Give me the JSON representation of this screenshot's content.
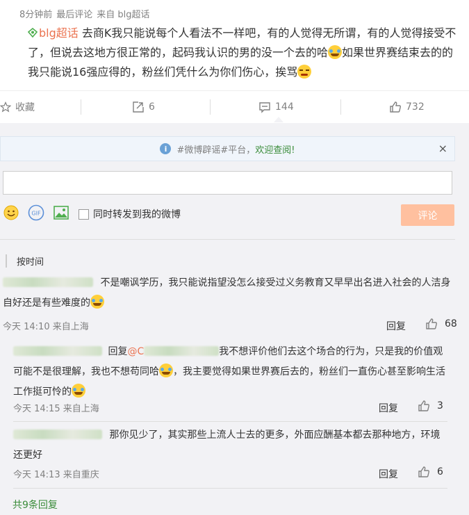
{
  "post": {
    "meta_time": "8分钟前",
    "meta_edit": "最后评论",
    "meta_source": "来自 blg超话",
    "topic": "blg超话",
    "text": "去商K我只能说每个人看法不一样吧，有的人觉得无所谓，有的人觉得接受不了，但说去这地方很正常的，起码我认识的男的没一个去的哈",
    "text2": "如果世界赛结束去的的我只能说16强应得的，粉丝们凭什么为你们伤心，挨骂"
  },
  "actions": {
    "favorite": "收藏",
    "repost_count": "6",
    "comment_count": "144",
    "like_count": "732"
  },
  "notice": {
    "prefix": "#微博辟谣#平台，",
    "highlight": "欢迎查阅!",
    "close": "×"
  },
  "composer": {
    "repost_label": "同时转发到我的微博",
    "submit": "评论"
  },
  "sort": {
    "label": "按时间"
  },
  "comments": [
    {
      "text": "不是嘲讽学历，我只能说指望没怎么接受过义务教育又早早出名进入社会的人洁身自好还是有些难度的",
      "time": "今天 14:10 来自上海",
      "reply": "回复",
      "likes": "68"
    }
  ],
  "replies": [
    {
      "prefix": "回复",
      "mention": "@C",
      "text": "我不想评价他们去这个场合的行为，只是我的价值观可能不是很理解，我也不想苟同哈",
      "text2": "，我主要觉得如果世界赛后去的，粉丝们一直伤心甚至影响生活工作挺可怜的",
      "time": "今天 14:15 来自上海",
      "reply": "回复",
      "likes": "3"
    },
    {
      "text": "那你见少了，其实那些上流人士去的更多，外面应酬基本都去那种地方，环境还更好",
      "time": "今天 14:13 来自重庆",
      "reply": "回复",
      "likes": "6"
    }
  ],
  "more_replies": "共9条回复",
  "icons": [
    "topic-icon",
    "star-icon",
    "repost-icon",
    "comment-icon",
    "like-icon",
    "info-icon",
    "close-icon",
    "emoji-icon",
    "gif-icon",
    "image-icon",
    "checkbox"
  ]
}
